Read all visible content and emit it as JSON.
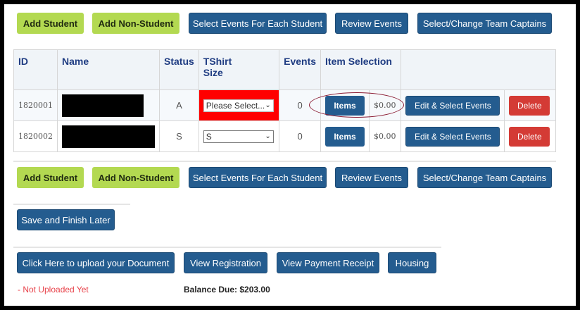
{
  "toolbar_top": {
    "add_student": "Add Student",
    "add_non_student": "Add Non-Student",
    "select_events": "Select Events For Each Student",
    "review_events": "Review Events",
    "team_captains": "Select/Change Team Captains"
  },
  "toolbar_bottom": {
    "add_student": "Add Student",
    "add_non_student": "Add Non-Student",
    "select_events": "Select Events For Each Student",
    "review_events": "Review Events",
    "team_captains": "Select/Change Team Captains"
  },
  "table": {
    "headers": {
      "id": "ID",
      "name": "Name",
      "status": "Status",
      "tshirt_line1": "TShirt",
      "tshirt_line2": "Size",
      "events": "Events",
      "item_selection": "Item Selection"
    },
    "rows": [
      {
        "id": "1820001",
        "status": "A",
        "tshirt": "Please Select...",
        "events": "0",
        "items_label": "Items",
        "amount": "$0.00",
        "edit_label": "Edit & Select Events",
        "delete_label": "Delete"
      },
      {
        "id": "1820002",
        "status": "S",
        "tshirt": "S",
        "events": "0",
        "items_label": "Items",
        "amount": "$0.00",
        "edit_label": "Edit & Select Events",
        "delete_label": "Delete"
      }
    ]
  },
  "save_later": "Save and Finish Later",
  "footer": {
    "upload_doc": "Click Here to upload your Document",
    "view_registration": "View Registration",
    "view_receipt": "View Payment Receipt",
    "housing": "Housing",
    "not_uploaded": "- Not Uploaded Yet",
    "balance_due": "Balance Due: $203.00"
  },
  "colors": {
    "green_button": "#b3d951",
    "blue_button": "#245c8f",
    "delete_red": "#d43b35",
    "error_cell": "#ff0000",
    "not_uploaded_text": "#e8434b",
    "header_text": "#1f3c82"
  }
}
